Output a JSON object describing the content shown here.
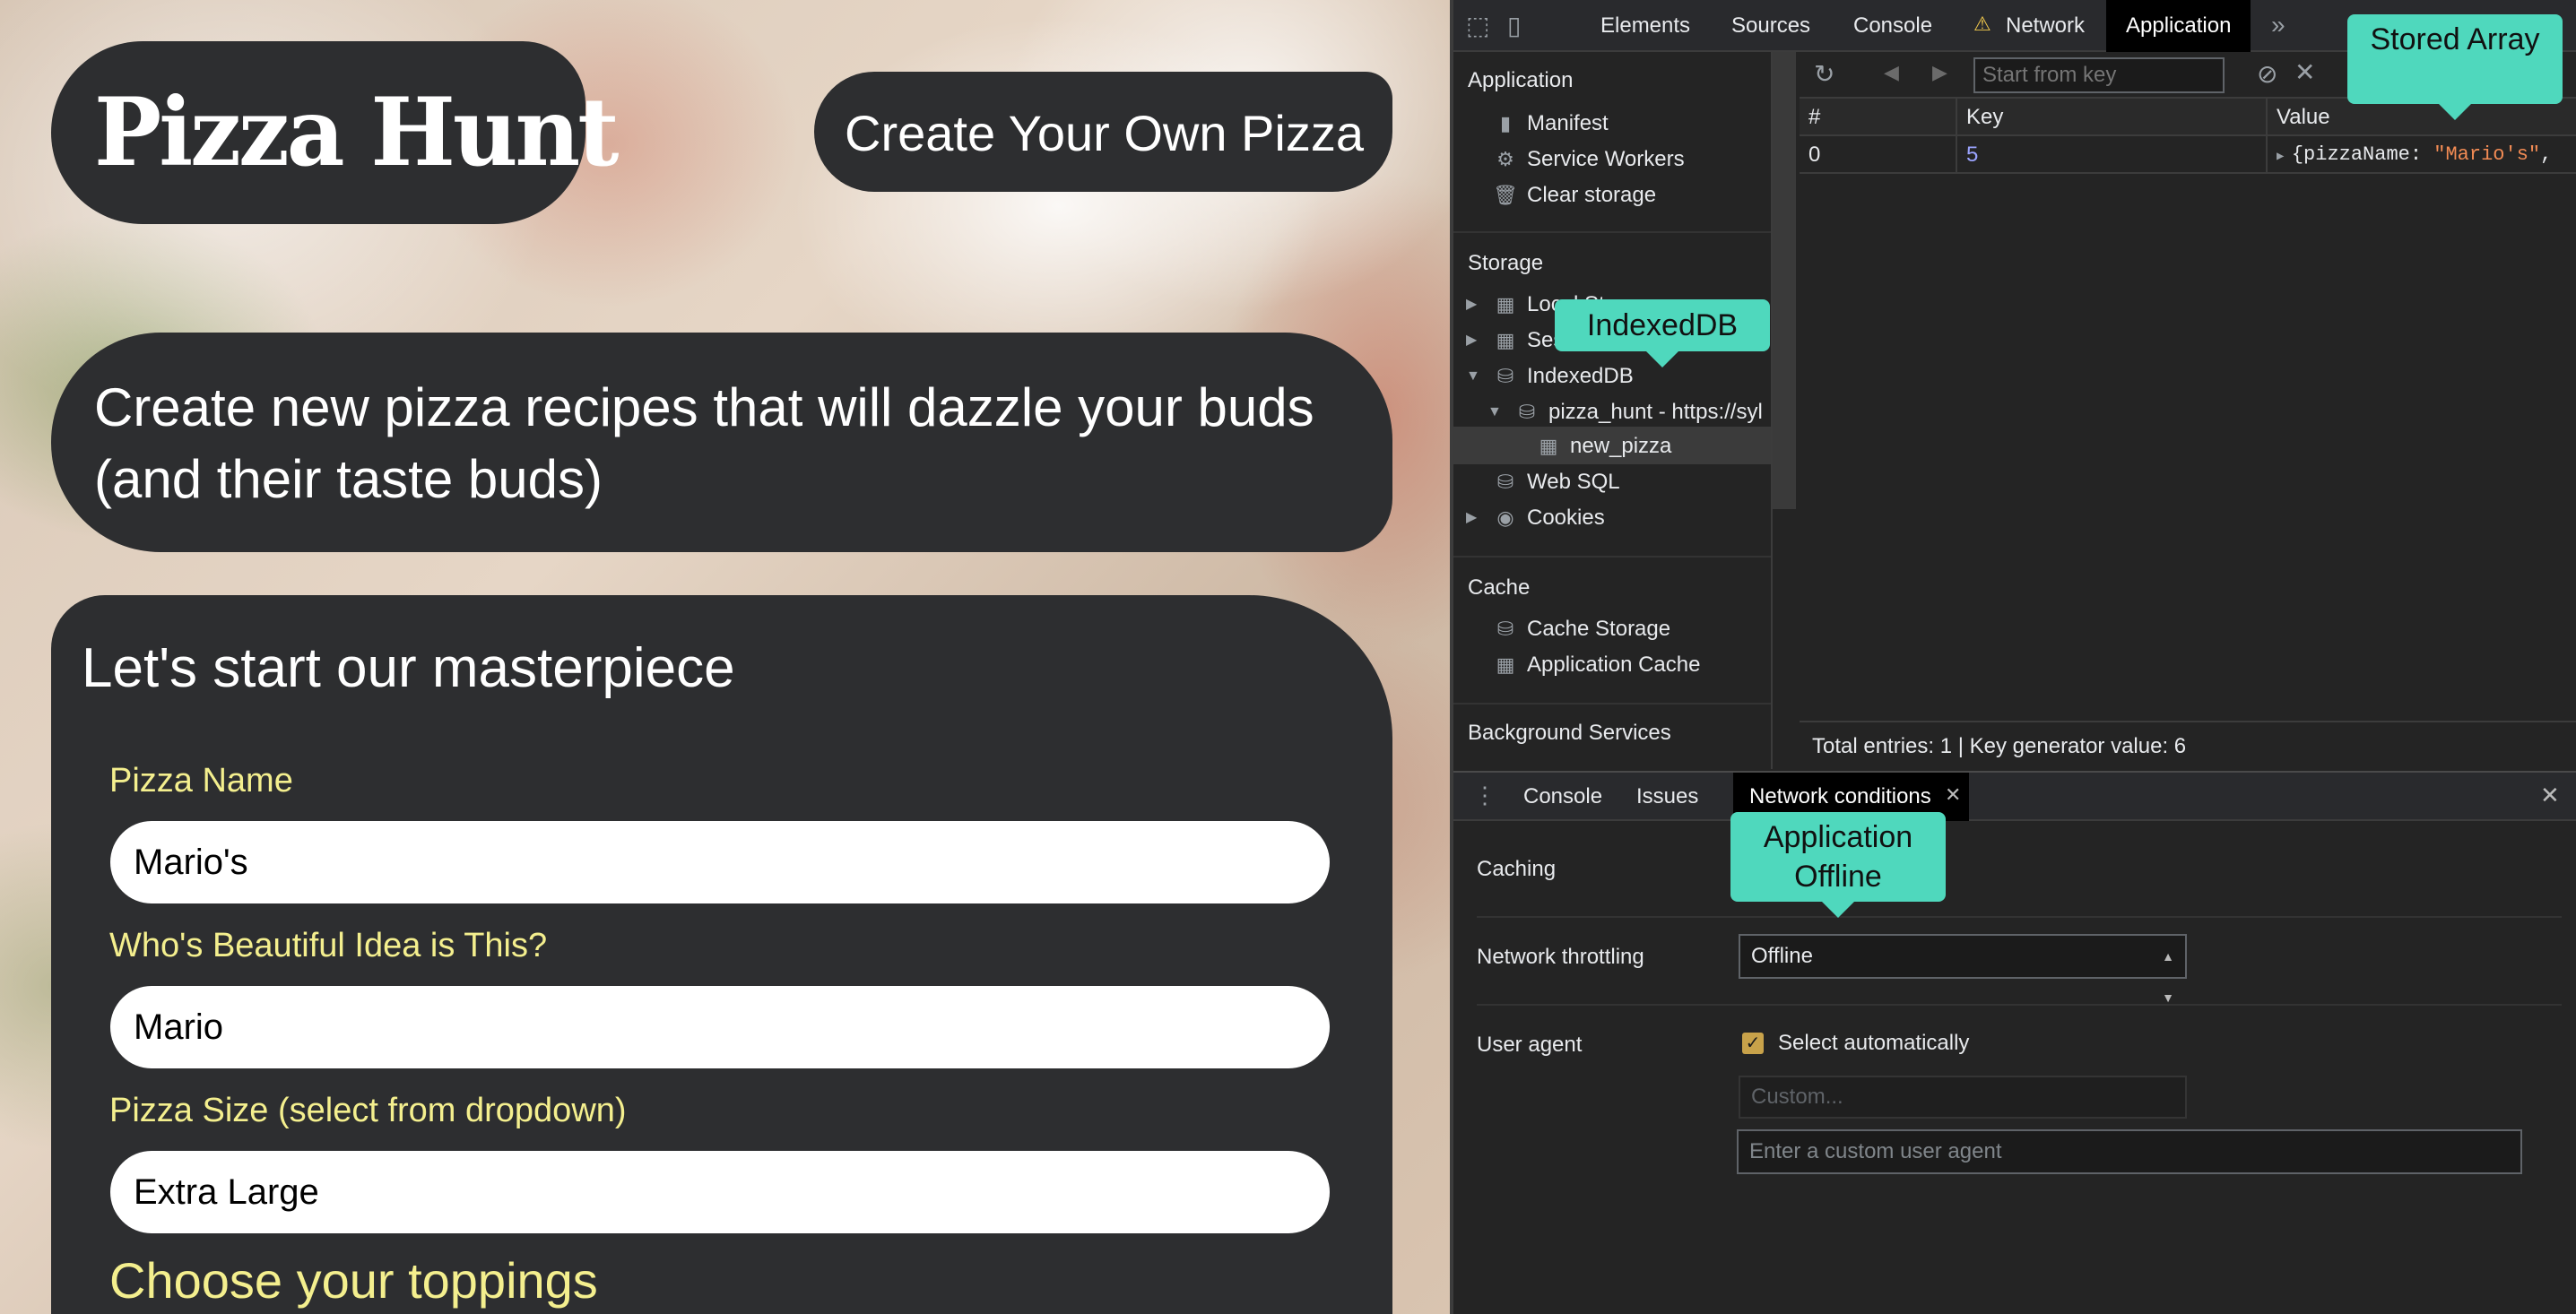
{
  "site": {
    "logo": "Pizza Hunt",
    "create_link": "Create Your Own Pizza",
    "tagline": "Create new pizza recipes that will dazzle your buds (and their taste buds)",
    "form": {
      "title": "Let's start our masterpiece",
      "fields": [
        {
          "label": "Pizza Name",
          "value": "Mario's"
        },
        {
          "label": "Who's Beautiful Idea is This?",
          "value": "Mario"
        },
        {
          "label": "Pizza Size (select from dropdown)",
          "value": "Extra Large"
        }
      ],
      "toppings_title": "Choose your toppings"
    }
  },
  "devtools": {
    "tabs": [
      "Elements",
      "Sources",
      "Console",
      "Network",
      "Application"
    ],
    "active_tab": "Application",
    "sidebar": {
      "application_heading": "Application",
      "application_items": [
        "Manifest",
        "Service Workers",
        "Clear storage"
      ],
      "storage_heading": "Storage",
      "storage_items": [
        "Local Storage",
        "Session Storage",
        "IndexedDB",
        "pizza_hunt - https://syl",
        "new_pizza",
        "Web SQL",
        "Cookies"
      ],
      "cache_heading": "Cache",
      "cache_items": [
        "Cache Storage",
        "Application Cache"
      ],
      "background_heading": "Background Services"
    },
    "toolbar": {
      "start_key_placeholder": "Start from key"
    },
    "table": {
      "columns": [
        "#",
        "Key",
        "Value"
      ],
      "rows": [
        {
          "index": "0",
          "key": "5",
          "value_prefix": "{pizzaName: ",
          "value_string": "\"Mario's\"",
          "value_suffix": ","
        }
      ]
    },
    "status": "Total entries: 1 | Key generator value: 6",
    "drawer": {
      "tabs": [
        "Console",
        "Issues",
        "Network conditions"
      ],
      "active_tab": "Network conditions",
      "caching_label": "Caching",
      "throttling_label": "Network throttling",
      "throttling_value": "Offline",
      "user_agent_label": "User agent",
      "select_auto_label": "Select automatically",
      "select_auto_checked": true,
      "custom_placeholder": "Custom...",
      "ua_input_placeholder": "Enter a custom user agent"
    }
  },
  "annotations": {
    "stored_array": "Stored Array",
    "indexeddb": "IndexedDB",
    "application_offline": "Application Offline"
  },
  "colors": {
    "accent_yellow": "#f4ef8e",
    "callout_teal": "#4fd8bd",
    "card_dark": "#2d2e30"
  }
}
